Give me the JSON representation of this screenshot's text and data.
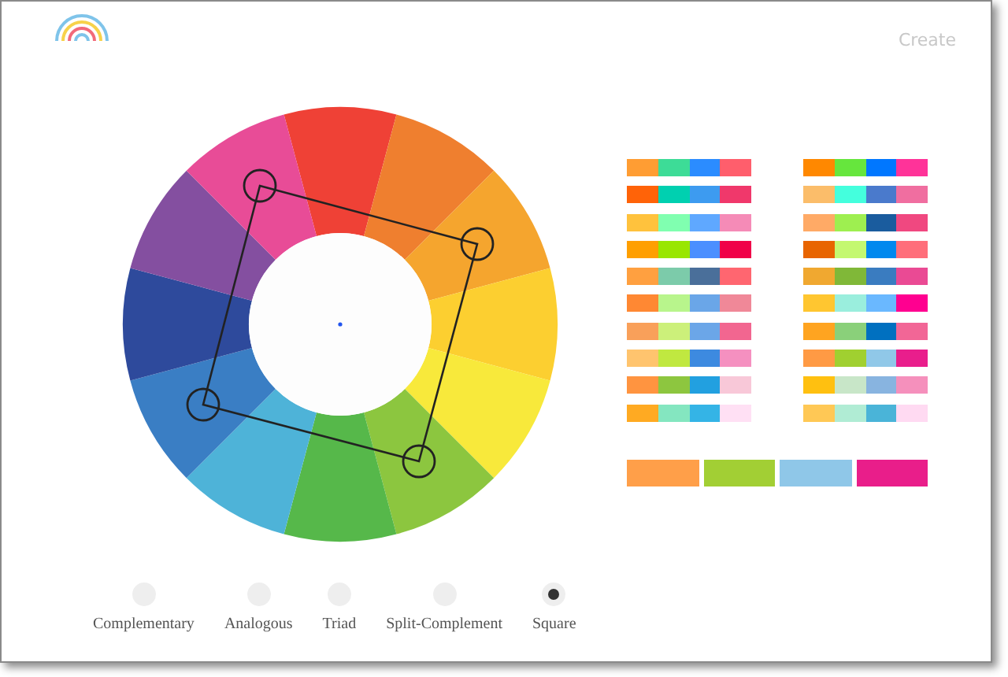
{
  "header": {
    "create_link": "Create"
  },
  "wheel": {
    "segments": [
      {
        "color": "#ef4136"
      },
      {
        "color": "#ef7f2f"
      },
      {
        "color": "#f5a52e"
      },
      {
        "color": "#fccf30"
      },
      {
        "color": "#f8e93b"
      },
      {
        "color": "#8cc63f"
      },
      {
        "color": "#56b84a"
      },
      {
        "color": "#4eb3d8"
      },
      {
        "color": "#3a7ec4"
      },
      {
        "color": "#2e4a9c"
      },
      {
        "color": "#844fa0"
      },
      {
        "color": "#e84c97"
      }
    ]
  },
  "palettes": [
    {
      "colors": [
        {
          "color": "#ff9d33"
        },
        {
          "color": "#3ddc97"
        },
        {
          "color": "#2b8cff"
        },
        {
          "color": "#ff5e6c"
        }
      ]
    },
    {
      "colors": [
        {
          "color": "#ff8800"
        },
        {
          "color": "#66e63d"
        },
        {
          "color": "#0077ff"
        },
        {
          "color": "#ff3399"
        }
      ]
    },
    {
      "colors": [
        {
          "color": "#ff6308"
        },
        {
          "color": "#00d0b0"
        },
        {
          "color": "#3d9bf0"
        },
        {
          "color": "#f0386b"
        }
      ]
    },
    {
      "colors": [
        {
          "color": "#fbbd6a"
        },
        {
          "color": "#44ffdd"
        },
        {
          "color": "#4a7acc"
        },
        {
          "color": "#f06ea0"
        }
      ]
    },
    {
      "colors": [
        {
          "color": "#ffc23d"
        },
        {
          "color": "#80ffb0"
        },
        {
          "color": "#5fa8ff"
        },
        {
          "color": "#f58bb7"
        }
      ]
    },
    {
      "colors": [
        {
          "color": "#ffaa66"
        },
        {
          "color": "#9eef50"
        },
        {
          "color": "#1a5c9e"
        },
        {
          "color": "#f04880"
        }
      ]
    },
    {
      "colors": [
        {
          "color": "#ff9f00"
        },
        {
          "color": "#99e600"
        },
        {
          "color": "#4b8fff"
        },
        {
          "color": "#f00048"
        }
      ]
    },
    {
      "colors": [
        {
          "color": "#e86400"
        },
        {
          "color": "#c4f870"
        },
        {
          "color": "#0088ee"
        },
        {
          "color": "#ff6e7a"
        }
      ]
    },
    {
      "colors": [
        {
          "color": "#ffa040"
        },
        {
          "color": "#7ccbaa"
        },
        {
          "color": "#4a6f9a"
        },
        {
          "color": "#ff6670"
        }
      ]
    },
    {
      "colors": [
        {
          "color": "#f0a830"
        },
        {
          "color": "#80b838"
        },
        {
          "color": "#3a7cc0"
        },
        {
          "color": "#ea4a94"
        }
      ]
    },
    {
      "colors": [
        {
          "color": "#ff8833"
        },
        {
          "color": "#b8f58c"
        },
        {
          "color": "#6aa6e8"
        },
        {
          "color": "#f08898"
        }
      ]
    },
    {
      "colors": [
        {
          "color": "#ffc630"
        },
        {
          "color": "#9aeedd"
        },
        {
          "color": "#6ab8ff"
        },
        {
          "color": "#ff0090"
        }
      ]
    },
    {
      "colors": [
        {
          "color": "#f9a05a"
        },
        {
          "color": "#ccf07a"
        },
        {
          "color": "#6ba6e8"
        },
        {
          "color": "#f26690"
        }
      ]
    },
    {
      "colors": [
        {
          "color": "#ffa420"
        },
        {
          "color": "#8ad07a"
        },
        {
          "color": "#0070c0"
        },
        {
          "color": "#f26696"
        }
      ]
    },
    {
      "colors": [
        {
          "color": "#ffc46e"
        },
        {
          "color": "#c0e840"
        },
        {
          "color": "#3d8ae0"
        },
        {
          "color": "#f590c0"
        }
      ]
    },
    {
      "colors": [
        {
          "color": "#ff9a44"
        },
        {
          "color": "#a0d030"
        },
        {
          "color": "#90c8e8"
        },
        {
          "color": "#e91e8c"
        }
      ]
    },
    {
      "colors": [
        {
          "color": "#ff9440"
        },
        {
          "color": "#8dc63f"
        },
        {
          "color": "#22a0e0"
        },
        {
          "color": "#f8c8d8"
        }
      ]
    },
    {
      "colors": [
        {
          "color": "#ffc010"
        },
        {
          "color": "#c8e6c8"
        },
        {
          "color": "#88b4e0"
        },
        {
          "color": "#f590bc"
        }
      ]
    },
    {
      "colors": [
        {
          "color": "#ffaa22"
        },
        {
          "color": "#84e6c0"
        },
        {
          "color": "#34b4e6"
        },
        {
          "color": "#ffe0f4"
        }
      ]
    },
    {
      "colors": [
        {
          "color": "#ffc855"
        },
        {
          "color": "#b0ecd4"
        },
        {
          "color": "#4ab4d8"
        },
        {
          "color": "#ffdaf2"
        }
      ]
    }
  ],
  "chosen_palette": {
    "colors": [
      {
        "color": "#ff9f49"
      },
      {
        "color": "#a2cf34"
      },
      {
        "color": "#8fc7e8"
      },
      {
        "color": "#e91e8a"
      }
    ]
  },
  "schemes": [
    {
      "label": "Complementary",
      "selected": false
    },
    {
      "label": "Analogous",
      "selected": false
    },
    {
      "label": "Triad",
      "selected": false
    },
    {
      "label": "Split-Complement",
      "selected": false
    },
    {
      "label": "Square",
      "selected": true
    }
  ]
}
